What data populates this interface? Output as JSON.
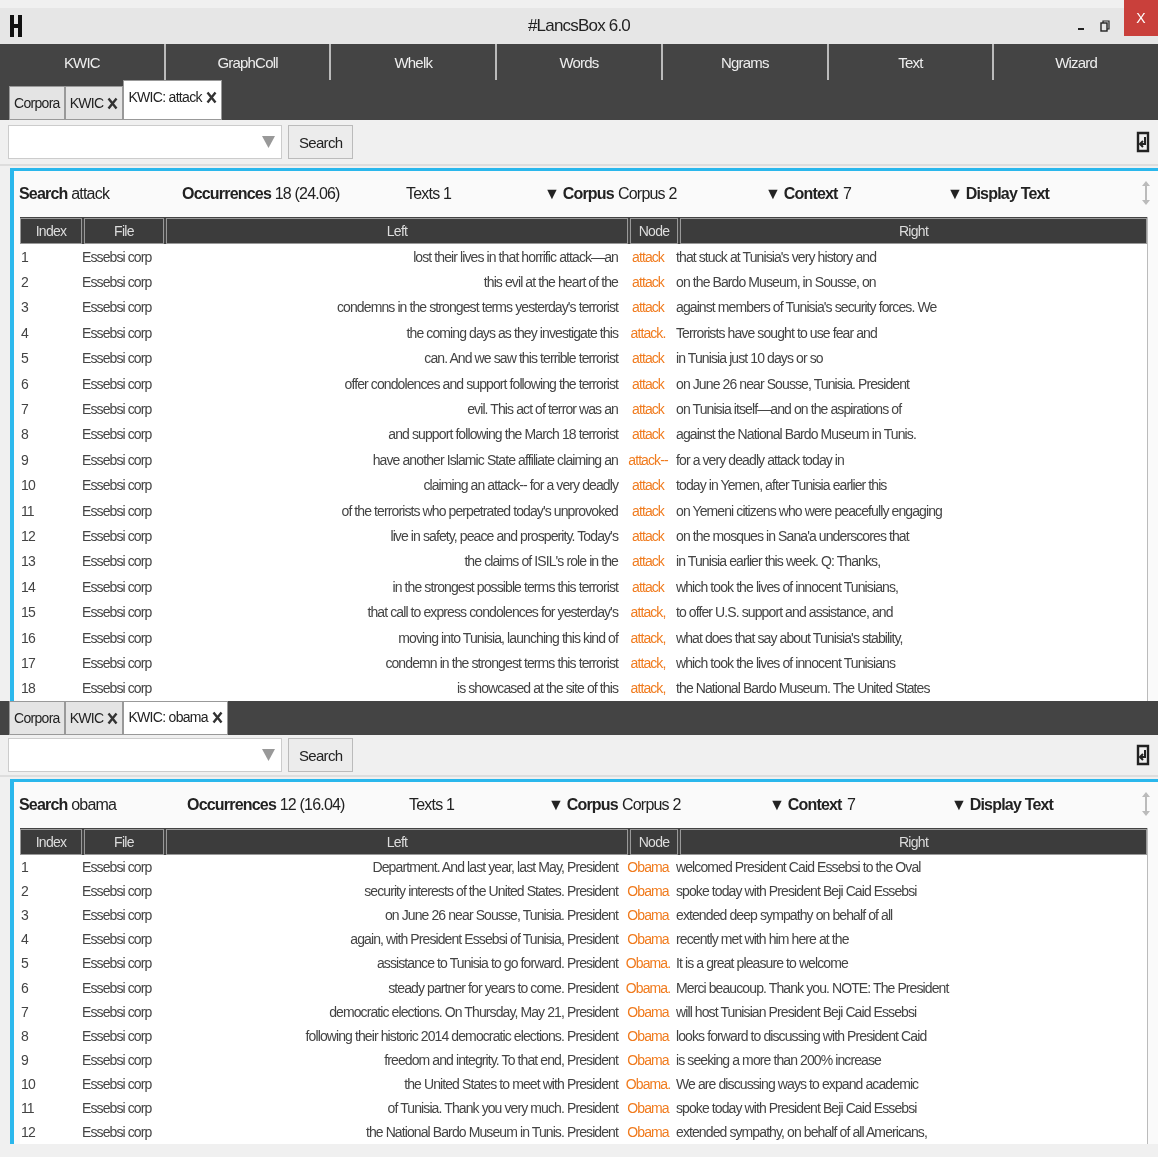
{
  "window": {
    "title": "#LancsBox 6.0",
    "close": "X"
  },
  "tools": [
    {
      "label": "KWIC"
    },
    {
      "label": "GraphColl"
    },
    {
      "label": "Whelk"
    },
    {
      "label": "Words"
    },
    {
      "label": "Ngrams"
    },
    {
      "label": "Text"
    },
    {
      "label": "Wizard"
    }
  ],
  "panes": [
    {
      "tabs": [
        {
          "label": "Corpora",
          "closable": false,
          "selected": false
        },
        {
          "label": "KWIC",
          "closable": true,
          "selected": false
        },
        {
          "label": "KWIC: attack",
          "closable": true,
          "selected": true
        }
      ],
      "search_button": "Search",
      "summary": {
        "search_label": "Search",
        "search_value": "attack",
        "occurrences_label": "Occurrences",
        "occurrences_value": "18 (24.06)",
        "texts": "Texts 1",
        "corpus_label": "▼ Corpus",
        "corpus_value": "Corpus 2",
        "context_label": "▼ Context",
        "context_value": "7",
        "display_label": "▼ Display Text"
      },
      "columns": [
        "Index",
        "File",
        "Left",
        "Node",
        "Right"
      ],
      "rows": [
        {
          "index": "1",
          "file": "Essebsi corp",
          "left": "lost their lives in that horrific attack—an",
          "node": "attack",
          "right": "that stuck at Tunisia's very history and"
        },
        {
          "index": "2",
          "file": "Essebsi corp",
          "left": "this evil at the heart of the",
          "node": "attack",
          "right": "on the Bardo Museum, in Sousse, on"
        },
        {
          "index": "3",
          "file": "Essebsi corp",
          "left": "condemns in the strongest terms yesterday's terrorist",
          "node": "attack",
          "right": "against members of Tunisia's security forces. We"
        },
        {
          "index": "4",
          "file": "Essebsi corp",
          "left": "the coming days as they investigate this",
          "node": "attack.",
          "right": "Terrorists have sought to use fear and"
        },
        {
          "index": "5",
          "file": "Essebsi corp",
          "left": "can. And we saw this terrible terrorist",
          "node": "attack",
          "right": "in Tunisia just 10 days or so"
        },
        {
          "index": "6",
          "file": "Essebsi corp",
          "left": "offer condolences and support following the terrorist",
          "node": "attack",
          "right": "on June 26 near Sousse, Tunisia. President"
        },
        {
          "index": "7",
          "file": "Essebsi corp",
          "left": "evil. This act of terror was an",
          "node": "attack",
          "right": "on Tunisia itself—and on the aspirations of"
        },
        {
          "index": "8",
          "file": "Essebsi corp",
          "left": "and support following the March 18 terrorist",
          "node": "attack",
          "right": "against the National Bardo Museum in Tunis."
        },
        {
          "index": "9",
          "file": "Essebsi corp",
          "left": "have another Islamic State affiliate claiming an",
          "node": "attack--",
          "right": "for a very deadly attack today in"
        },
        {
          "index": "10",
          "file": "Essebsi corp",
          "left": "claiming an attack-- for a very deadly",
          "node": "attack",
          "right": "today in Yemen, after Tunisia earlier this"
        },
        {
          "index": "11",
          "file": "Essebsi corp",
          "left": "of the terrorists who perpetrated today's unprovoked",
          "node": "attack",
          "right": "on Yemeni citizens who were peacefully engaging"
        },
        {
          "index": "12",
          "file": "Essebsi corp",
          "left": "live in safety, peace and prosperity. Today's",
          "node": "attack",
          "right": "on the mosques in Sana'a underscores that"
        },
        {
          "index": "13",
          "file": "Essebsi corp",
          "left": "the claims of ISIL's role in the",
          "node": "attack",
          "right": "in Tunisia earlier this week. Q: Thanks,"
        },
        {
          "index": "14",
          "file": "Essebsi corp",
          "left": "in the strongest possible terms this terrorist",
          "node": "attack",
          "right": "which took the lives of innocent Tunisians,"
        },
        {
          "index": "15",
          "file": "Essebsi corp",
          "left": "that call to express condolences for yesterday's",
          "node": "attack,",
          "right": "to offer U.S. support and assistance, and"
        },
        {
          "index": "16",
          "file": "Essebsi corp",
          "left": "moving into Tunisia, launching this kind of",
          "node": "attack,",
          "right": "what does that say about Tunisia's stability,"
        },
        {
          "index": "17",
          "file": "Essebsi corp",
          "left": "condemn in the strongest terms this terrorist",
          "node": "attack,",
          "right": "which took the lives of innocent Tunisians"
        },
        {
          "index": "18",
          "file": "Essebsi corp",
          "left": "is showcased at the site of this",
          "node": "attack,",
          "right": "the National Bardo Museum. The United States"
        }
      ]
    },
    {
      "tabs": [
        {
          "label": "Corpora",
          "closable": false,
          "selected": false
        },
        {
          "label": "KWIC",
          "closable": true,
          "selected": false
        },
        {
          "label": "KWIC: obama",
          "closable": true,
          "selected": true
        }
      ],
      "search_button": "Search",
      "summary": {
        "search_label": "Search",
        "search_value": "obama",
        "occurrences_label": "Occurrences",
        "occurrences_value": "12 (16.04)",
        "texts": "Texts 1",
        "corpus_label": "▼ Corpus",
        "corpus_value": "Corpus 2",
        "context_label": "▼ Context",
        "context_value": "7",
        "display_label": "▼ Display Text"
      },
      "columns": [
        "Index",
        "File",
        "Left",
        "Node",
        "Right"
      ],
      "rows": [
        {
          "index": "1",
          "file": "Essebsi corp",
          "left": "Department. And last year, last May, President",
          "node": "Obama",
          "right": "welcomed President Caid Essebsi to the Oval"
        },
        {
          "index": "2",
          "file": "Essebsi corp",
          "left": "security interests of the United States. President",
          "node": "Obama",
          "right": "spoke today with President Beji Caid Essebsi"
        },
        {
          "index": "3",
          "file": "Essebsi corp",
          "left": "on June 26 near Sousse, Tunisia. President",
          "node": "Obama",
          "right": "extended deep sympathy on behalf of all"
        },
        {
          "index": "4",
          "file": "Essebsi corp",
          "left": "again, with President Essebsi of Tunisia, President",
          "node": "Obama",
          "right": "recently met with him here at the"
        },
        {
          "index": "5",
          "file": "Essebsi corp",
          "left": "assistance to Tunisia to go forward. President",
          "node": "Obama.",
          "right": "It is a great pleasure to welcome"
        },
        {
          "index": "6",
          "file": "Essebsi corp",
          "left": "steady partner for years to come. President",
          "node": "Obama.",
          "right": "Merci beaucoup. Thank you. NOTE: The President"
        },
        {
          "index": "7",
          "file": "Essebsi corp",
          "left": "democratic elections. On Thursday, May 21, President",
          "node": "Obama",
          "right": "will host Tunisian President Beji Caid Essebsi"
        },
        {
          "index": "8",
          "file": "Essebsi corp",
          "left": "following their historic 2014 democratic elections. President",
          "node": "Obama",
          "right": "looks forward to discussing with President Caid"
        },
        {
          "index": "9",
          "file": "Essebsi corp",
          "left": "freedom and integrity. To that end, President",
          "node": "Obama",
          "right": "is seeking a more than 200% increase"
        },
        {
          "index": "10",
          "file": "Essebsi corp",
          "left": "the United States to meet with President",
          "node": "Obama.",
          "right": "We are discussing ways to expand academic"
        },
        {
          "index": "11",
          "file": "Essebsi corp",
          "left": "of Tunisia. Thank you very much. President",
          "node": "Obama",
          "right": "spoke today with President Beji Caid Essebsi"
        },
        {
          "index": "12",
          "file": "Essebsi corp",
          "left": "the National Bardo Museum in Tunis. President",
          "node": "Obama",
          "right": "extended sympathy, on behalf of all Americans,"
        }
      ]
    }
  ]
}
